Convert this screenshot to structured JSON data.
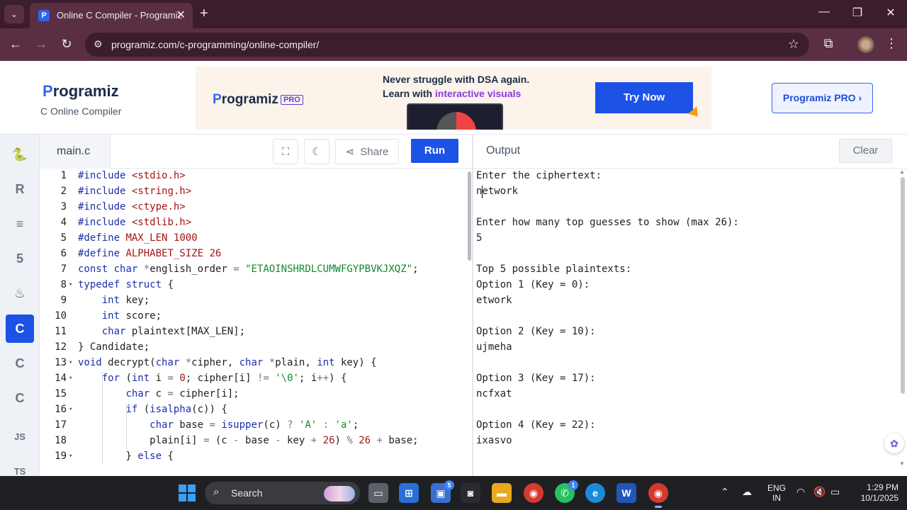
{
  "browser": {
    "tab_title": "Online C Compiler - Programiz",
    "url": "programiz.com/c-programming/online-compiler/"
  },
  "header": {
    "logo": "rogramiz",
    "logo_p": "P",
    "subtitle": "C Online Compiler",
    "pro_button": "Programiz PRO ›"
  },
  "ad": {
    "logo": "rogramiz",
    "logo_p": "P",
    "pro_tag": "PRO",
    "line1": "Never struggle with DSA again.",
    "line2_prefix": "Learn with ",
    "line2_highlight": "interactive visuals",
    "button": "Try Now"
  },
  "sidebar": {
    "items": [
      {
        "icon": "python-icon",
        "glyph": "🐍"
      },
      {
        "icon": "r-icon",
        "glyph": "R"
      },
      {
        "icon": "sql-icon",
        "glyph": "≡"
      },
      {
        "icon": "html-icon",
        "glyph": "5"
      },
      {
        "icon": "java-icon",
        "glyph": "♨"
      },
      {
        "icon": "c-icon",
        "glyph": "C"
      },
      {
        "icon": "cpp-icon",
        "glyph": "C"
      },
      {
        "icon": "csharp-icon",
        "glyph": "C"
      },
      {
        "icon": "js-icon",
        "glyph": "JS"
      },
      {
        "icon": "ts-icon",
        "glyph": "TS"
      }
    ]
  },
  "editor": {
    "file_name": "main.c",
    "share_label": "Share",
    "run_label": "Run",
    "lines": [
      {
        "n": "1",
        "fold": "",
        "code": "#include <stdio.h>"
      },
      {
        "n": "2",
        "fold": "",
        "code": "#include <string.h>"
      },
      {
        "n": "3",
        "fold": "",
        "code": "#include <ctype.h>"
      },
      {
        "n": "4",
        "fold": "",
        "code": "#include <stdlib.h>"
      },
      {
        "n": "5",
        "fold": "",
        "code": "#define MAX_LEN 1000"
      },
      {
        "n": "6",
        "fold": "",
        "code": "#define ALPHABET_SIZE 26"
      },
      {
        "n": "7",
        "fold": "",
        "code": "const char *english_order = \"ETAOINSHRDLCUMWFGYPBVKJXQZ\";"
      },
      {
        "n": "8",
        "fold": "▾",
        "code": "typedef struct {"
      },
      {
        "n": "9",
        "fold": "",
        "code": "    int key;"
      },
      {
        "n": "10",
        "fold": "",
        "code": "    int score;"
      },
      {
        "n": "11",
        "fold": "",
        "code": "    char plaintext[MAX_LEN];"
      },
      {
        "n": "12",
        "fold": "",
        "code": "} Candidate;"
      },
      {
        "n": "13",
        "fold": "▾",
        "code": "void decrypt(char *cipher, char *plain, int key) {"
      },
      {
        "n": "14",
        "fold": "▾",
        "code": "    for (int i = 0; cipher[i] != '\\0'; i++) {"
      },
      {
        "n": "15",
        "fold": "",
        "code": "        char c = cipher[i];"
      },
      {
        "n": "16",
        "fold": "▾",
        "code": "        if (isalpha(c)) {"
      },
      {
        "n": "17",
        "fold": "",
        "code": "            char base = isupper(c) ? 'A' : 'a';"
      },
      {
        "n": "18",
        "fold": "",
        "code": "            plain[i] = (c - base - key + 26) % 26 + base;"
      },
      {
        "n": "19",
        "fold": "▾",
        "code": "        } else {"
      }
    ]
  },
  "output": {
    "title": "Output",
    "clear_label": "Clear",
    "lines": [
      "Enter the ciphertext:",
      "network",
      "",
      "Enter how many top guesses to show (max 26):",
      "5",
      "",
      "Top 5 possible plaintexts:",
      "Option 1 (Key = 0):",
      "etwork",
      "",
      "Option 2 (Key = 10):",
      "ujmeha",
      "",
      "Option 3 (Key = 17):",
      "ncfxat",
      "",
      "Option 4 (Key = 22):",
      "ixasvo"
    ]
  },
  "taskbar": {
    "search_label": "Search",
    "store_badge": "5",
    "whatsapp_badge": "1",
    "lang_line1": "ENG",
    "lang_line2": "IN",
    "time": "1:29 PM",
    "date": "10/1/2025"
  }
}
